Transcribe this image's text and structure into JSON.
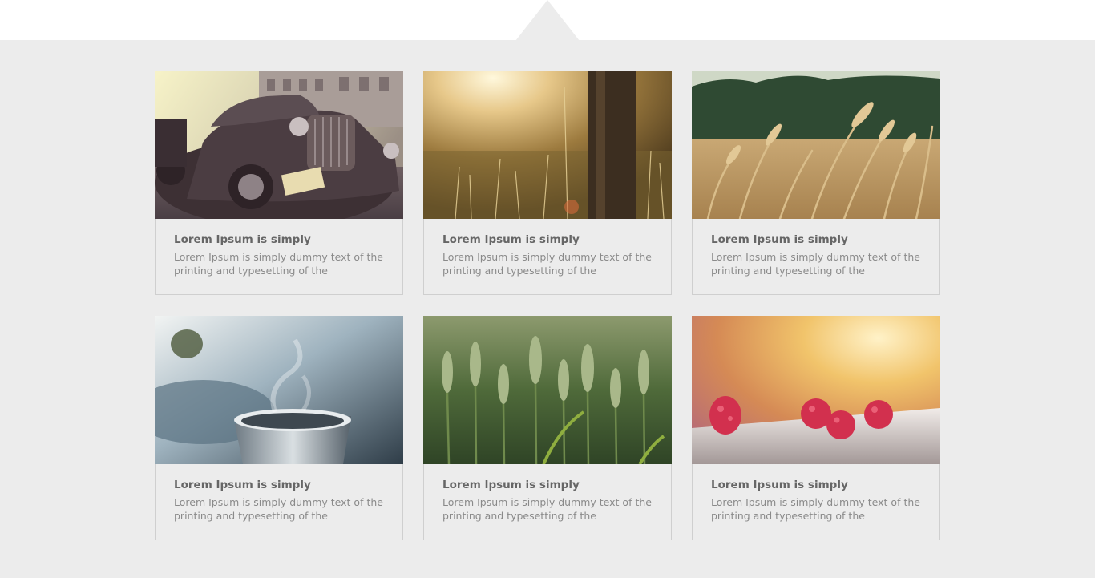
{
  "colors": {
    "page_background": "#ececec",
    "top_band": "#ffffff",
    "card_border": "#cfcfcf",
    "title_text": "#666666",
    "body_text": "#8a8a8a"
  },
  "cards": [
    {
      "image": "vintage-car-photo",
      "title": "Lorem Ipsum is simply",
      "text": "Lorem Ipsum is simply dummy text of the printing and typesetting of the"
    },
    {
      "image": "sunlit-meadow-tree-photo",
      "title": "Lorem Ipsum is simply",
      "text": "Lorem Ipsum is simply dummy text of the printing and typesetting of the"
    },
    {
      "image": "wheat-field-photo",
      "title": "Lorem Ipsum is simply",
      "text": "Lorem Ipsum is simply dummy text of the printing and typesetting of the"
    },
    {
      "image": "steaming-cup-photo",
      "title": "Lorem Ipsum is simply",
      "text": "Lorem Ipsum is simply dummy text of the printing and typesetting of the"
    },
    {
      "image": "green-wheat-photo",
      "title": "Lorem Ipsum is simply",
      "text": "Lorem Ipsum is simply dummy text of the printing and typesetting of the"
    },
    {
      "image": "raspberries-photo",
      "title": "Lorem Ipsum is simply",
      "text": "Lorem Ipsum is simply dummy text of the printing and typesetting of the"
    }
  ]
}
